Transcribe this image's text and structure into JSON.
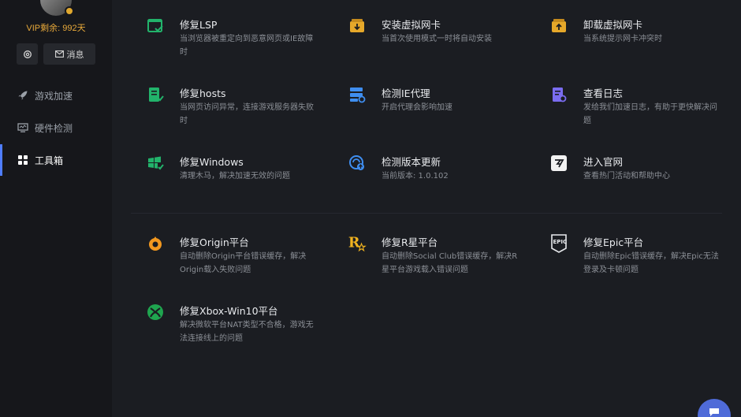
{
  "sidebar": {
    "vip_text": "VIP剩余: 992天",
    "message_label": "消息",
    "nav": [
      {
        "label": "游戏加速",
        "icon": "rocket-icon"
      },
      {
        "label": "硬件检测",
        "icon": "monitor-icon"
      },
      {
        "label": "工具箱",
        "icon": "grid-icon",
        "active": true
      }
    ]
  },
  "tools": [
    {
      "title": "修复LSP",
      "desc": "当浏览器被重定向到恶意网页或IE故障时",
      "icon": "browser-fix-icon"
    },
    {
      "title": "安装虚拟网卡",
      "desc": "当首次使用模式一时将自动安装",
      "icon": "install-box-icon"
    },
    {
      "title": "卸载虚拟网卡",
      "desc": "当系统提示网卡冲突时",
      "icon": "uninstall-box-icon"
    },
    {
      "title": "修复hosts",
      "desc": "当网页访问异常，连接游戏服务器失败时",
      "icon": "hosts-file-icon"
    },
    {
      "title": "检测IE代理",
      "desc": "开启代理会影响加速",
      "icon": "proxy-server-icon"
    },
    {
      "title": "查看日志",
      "desc": "发给我们加速日志，有助于更快解决问题",
      "icon": "log-file-icon"
    },
    {
      "title": "修复Windows",
      "desc": "清理木马，解决加速无效的问题",
      "icon": "windows-fix-icon"
    },
    {
      "title": "检测版本更新",
      "desc": "当前版本: 1.0.102",
      "icon": "update-globe-icon"
    },
    {
      "title": "进入官网",
      "desc": "查看热门活动和帮助中心",
      "icon": "website-logo-icon"
    }
  ],
  "platforms": [
    {
      "title": "修复Origin平台",
      "desc": "自动删除Origin平台错误缓存，解决Origin载入失败问题",
      "icon": "origin-icon"
    },
    {
      "title": "修复R星平台",
      "desc": "自动删除Social Club错误缓存，解决R星平台游戏载入错误问题",
      "icon": "rockstar-icon"
    },
    {
      "title": "修复Epic平台",
      "desc": "自动删除Epic错误缓存，解决Epic无法登录及卡顿问题",
      "icon": "epic-icon"
    },
    {
      "title": "修复Xbox-Win10平台",
      "desc": "解决微软平台NAT类型不合格，游戏无法连接线上的问题",
      "icon": "xbox-icon"
    }
  ],
  "colors": {
    "accent": "#4f7dff",
    "vip": "#e8a93a",
    "green": "#22b36b",
    "gold": "#e6a82a",
    "blue": "#3f8ef0",
    "purple": "#7a6cf0"
  }
}
